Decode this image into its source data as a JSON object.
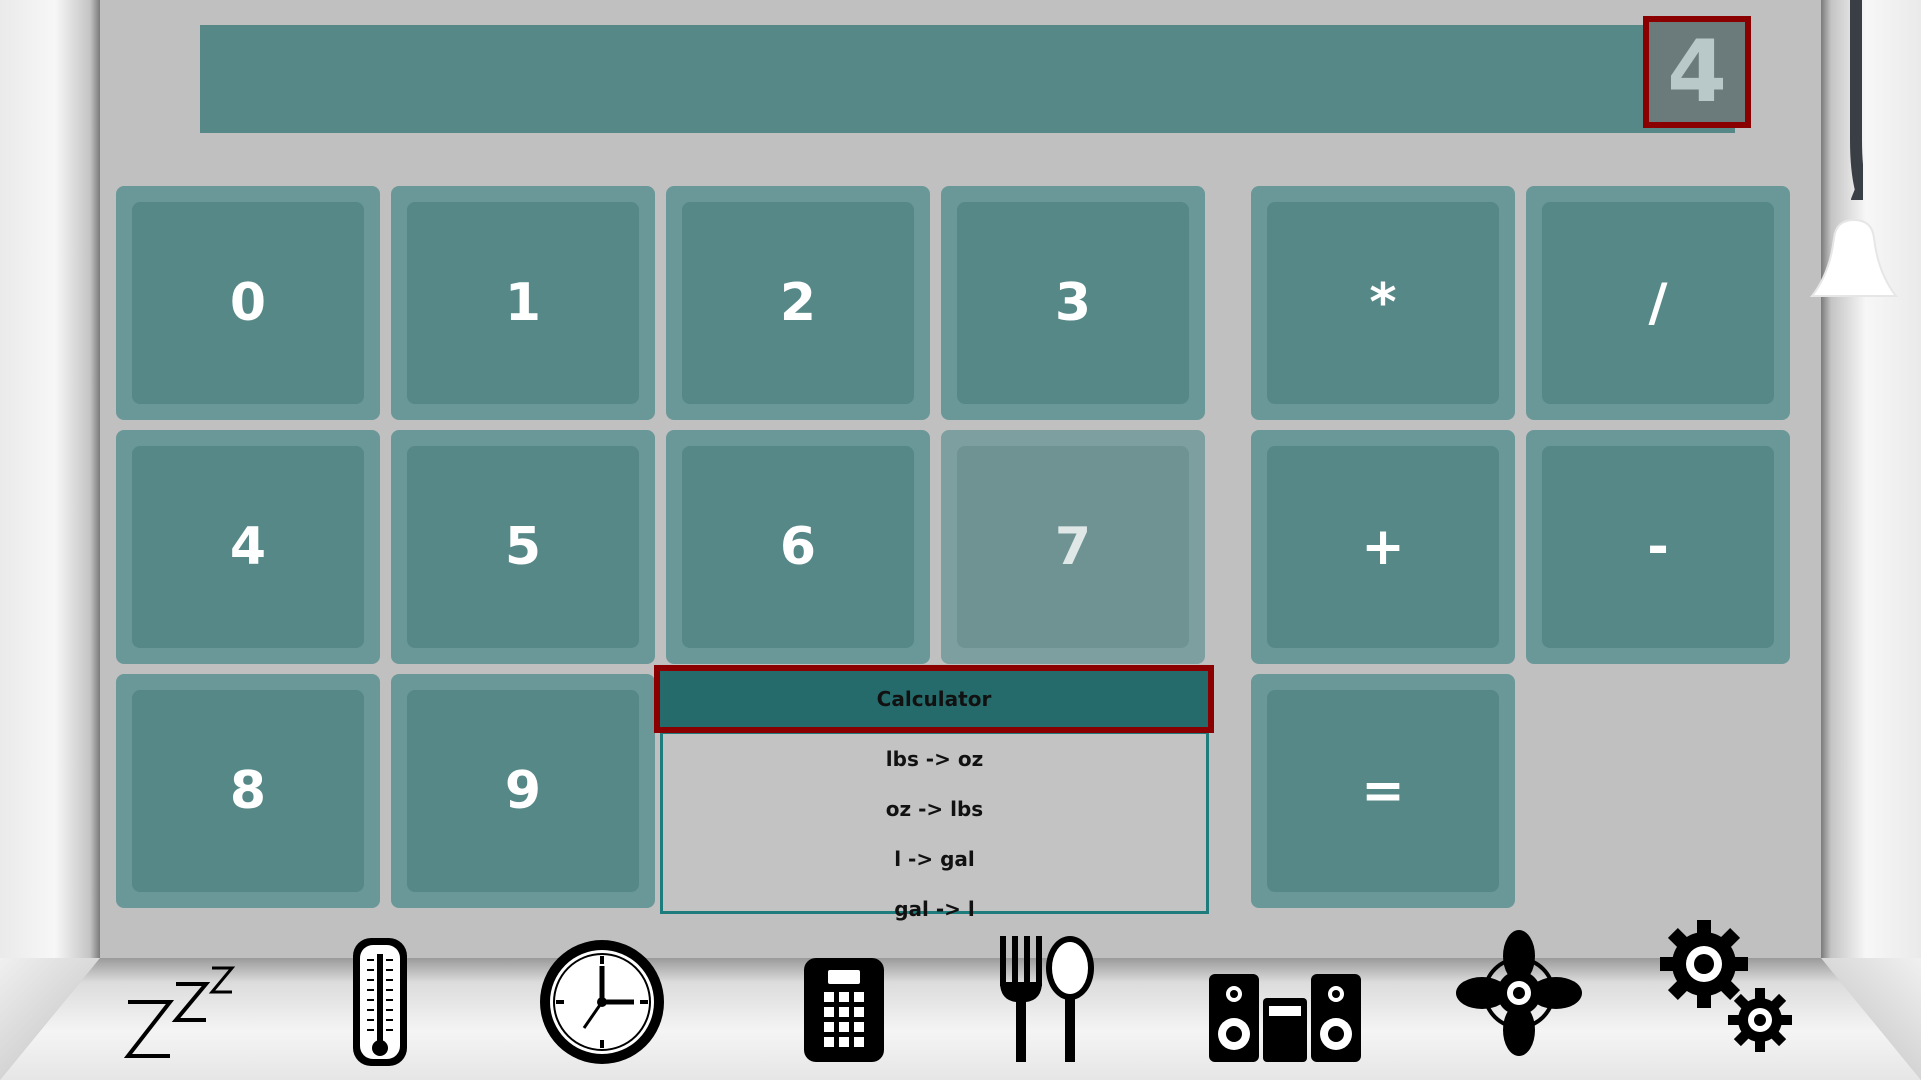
{
  "display": {
    "value": "4"
  },
  "keypad": {
    "digits": [
      "0",
      "1",
      "2",
      "3",
      "4",
      "5",
      "6",
      "7",
      "8",
      "9"
    ],
    "operators": {
      "multiply": "*",
      "divide": "/",
      "add": "+",
      "subtract": "-",
      "equals": "="
    }
  },
  "mode_select": {
    "selected": "Calculator",
    "options": [
      "lbs -> oz",
      "oz -> lbs",
      "l -> gal",
      "gal -> l"
    ]
  },
  "nav": {
    "icons": [
      "sleep-icon",
      "thermometer-icon",
      "clock-icon",
      "calculator-icon",
      "utensils-icon",
      "stereo-icon",
      "fan-icon",
      "settings-gears-icon"
    ]
  },
  "colors": {
    "key_face": "#578888",
    "key_bezel": "#6a9898",
    "selected_highlight": "#8a0000",
    "dropdown_border": "#1f7c7c"
  }
}
